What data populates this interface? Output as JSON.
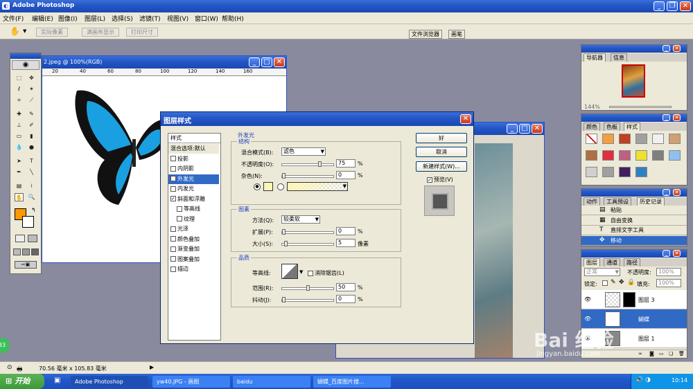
{
  "app": {
    "title": "Adobe Photoshop"
  },
  "menu": [
    "文件(F)",
    "编辑(E)",
    "图像(I)",
    "图层(L)",
    "选择(S)",
    "滤镜(T)",
    "视图(V)",
    "窗口(W)",
    "帮助(H)"
  ],
  "options": {
    "buttons": [
      "实际像素",
      "满画布显示",
      "打印尺寸"
    ],
    "well_tabs": [
      "文件浏览器",
      "画笔"
    ]
  },
  "doc1": {
    "title": "2.jpeg @ 100%(RGB)",
    "ruler": [
      "20",
      "40",
      "60",
      "80",
      "100",
      "120",
      "140",
      "160"
    ]
  },
  "status": {
    "size": "70.56 毫米 x 105.83 毫米",
    "zoom": "33"
  },
  "dialog": {
    "title": "图层样式",
    "list_header": "样式",
    "list_items": [
      {
        "label": "混合选项:默认",
        "check": false,
        "indent": false,
        "selected": false,
        "box": false
      },
      {
        "label": "投影",
        "check": false,
        "indent": false,
        "selected": false,
        "box": true
      },
      {
        "label": "内阴影",
        "check": false,
        "indent": false,
        "selected": false,
        "box": true
      },
      {
        "label": "外发光",
        "check": true,
        "indent": false,
        "selected": true,
        "box": true
      },
      {
        "label": "内发光",
        "check": false,
        "indent": false,
        "selected": false,
        "box": true
      },
      {
        "label": "斜面和浮雕",
        "check": true,
        "indent": false,
        "selected": false,
        "box": true
      },
      {
        "label": "等高线",
        "check": false,
        "indent": true,
        "selected": false,
        "box": true
      },
      {
        "label": "纹理",
        "check": false,
        "indent": true,
        "selected": false,
        "box": true
      },
      {
        "label": "光泽",
        "check": false,
        "indent": false,
        "selected": false,
        "box": true
      },
      {
        "label": "颜色叠加",
        "check": false,
        "indent": false,
        "selected": false,
        "box": true
      },
      {
        "label": "渐变叠加",
        "check": false,
        "indent": false,
        "selected": false,
        "box": true
      },
      {
        "label": "图案叠加",
        "check": false,
        "indent": false,
        "selected": false,
        "box": true
      },
      {
        "label": "描边",
        "check": false,
        "indent": false,
        "selected": false,
        "box": true
      }
    ],
    "section_title": "外发光",
    "structure": {
      "title": "结构",
      "blend_mode_label": "混合模式(B):",
      "blend_mode_value": "滤色",
      "opacity_label": "不透明度(O):",
      "opacity_value": "75",
      "opacity": 75,
      "noise_label": "杂色(N):",
      "noise_value": "0",
      "noise": 0
    },
    "elements": {
      "title": "图素",
      "method_label": "方法(Q):",
      "method_value": "较柔软",
      "spread_label": "扩展(P):",
      "spread_value": "0",
      "spread": 0,
      "size_label": "大小(S):",
      "size_value": "5",
      "size": 5,
      "size_unit": "像素"
    },
    "quality": {
      "title": "品质",
      "contour_label": "等高线:",
      "antialias_label": "消除锯齿(L)",
      "range_label": "范围(R):",
      "range_value": "50",
      "range": 50,
      "jitter_label": "抖动(J):",
      "jitter_value": "0",
      "jitter": 0
    },
    "percent": "%",
    "buttons": {
      "ok": "好",
      "cancel": "取消",
      "new_style": "新建样式(W)...",
      "preview": "预览(V)"
    }
  },
  "navigator": {
    "tabs": [
      "导航器",
      "信息"
    ],
    "zoom": "144%"
  },
  "styles": {
    "tabs": [
      "颜色",
      "色板",
      "样式"
    ]
  },
  "history": {
    "tabs": [
      "动作",
      "工具预设",
      "历史记录"
    ],
    "items": [
      {
        "label": "粘贴",
        "icon": "paste-icon",
        "selected": false
      },
      {
        "label": "自由变换",
        "icon": "transform-icon",
        "selected": false
      },
      {
        "label": "直排文字工具",
        "icon": "type-icon",
        "selected": false
      },
      {
        "label": "移动",
        "icon": "move-icon",
        "selected": true
      }
    ]
  },
  "layers": {
    "tabs": [
      "图层",
      "通道",
      "路径"
    ],
    "blend": "正常",
    "opacity_label": "不透明度:",
    "opacity_value": "100%",
    "lock_label": "锁定:",
    "fill_label": "填充:",
    "fill_value": "100%",
    "items": [
      {
        "name": "图层 3",
        "selected": false
      },
      {
        "name": "蝴蝶",
        "selected": true
      },
      {
        "name": "图层 1",
        "selected": false
      }
    ]
  },
  "taskbar": {
    "start": "开始",
    "tasks": [
      "Adobe Photoshop",
      "yw40.JPG - 画图",
      "baidu",
      "蝴蝶_百度图片搜..."
    ],
    "clock": "10:14"
  },
  "watermark": {
    "text": "Bai 经验",
    "url": "jingyan.baidu.com"
  },
  "colors": {
    "accent": "#316ac5",
    "foreground_swatch": "#ff9900",
    "butterfly_blue": "#1aa0e0"
  }
}
